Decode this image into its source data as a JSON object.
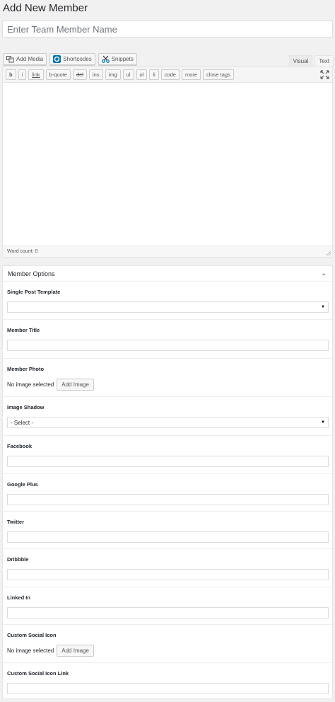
{
  "page": {
    "title": "Add New Member"
  },
  "title_field": {
    "placeholder": "Enter Team Member Name"
  },
  "media_buttons": {
    "add_media": "Add Media",
    "shortcodes": "Shortcodes",
    "snippets": "Snippets"
  },
  "editor_tabs": {
    "visual": "Visual",
    "text": "Text"
  },
  "quicktags": [
    "b",
    "i",
    "link",
    "b-quote",
    "del",
    "ins",
    "img",
    "ul",
    "ol",
    "li",
    "code",
    "more",
    "close tags"
  ],
  "status": {
    "word_count": "Word count: 0"
  },
  "member_options": {
    "heading": "Member Options",
    "single_post_template": {
      "label": "Single Post Template",
      "selected": ""
    },
    "member_title": {
      "label": "Member Title",
      "value": ""
    },
    "member_photo": {
      "label": "Member Photo",
      "status": "No image selected",
      "button": "Add Image"
    },
    "image_shadow": {
      "label": "Image Shadow",
      "selected": "- Select -"
    },
    "facebook": {
      "label": "Facebook",
      "value": ""
    },
    "google_plus": {
      "label": "Google Plus",
      "value": ""
    },
    "twitter": {
      "label": "Twitter",
      "value": ""
    },
    "dribbble": {
      "label": "Dribbble",
      "value": ""
    },
    "linked_in": {
      "label": "Linked In",
      "value": ""
    },
    "custom_social_icon": {
      "label": "Custom Social Icon",
      "status": "No image selected",
      "button": "Add Image"
    },
    "custom_social_icon_link": {
      "label": "Custom Social Icon Link",
      "value": ""
    }
  },
  "colors": {
    "background": "#f1f1f1",
    "border": "#e5e5e5",
    "shortcodes_icon": "#0073aa"
  }
}
